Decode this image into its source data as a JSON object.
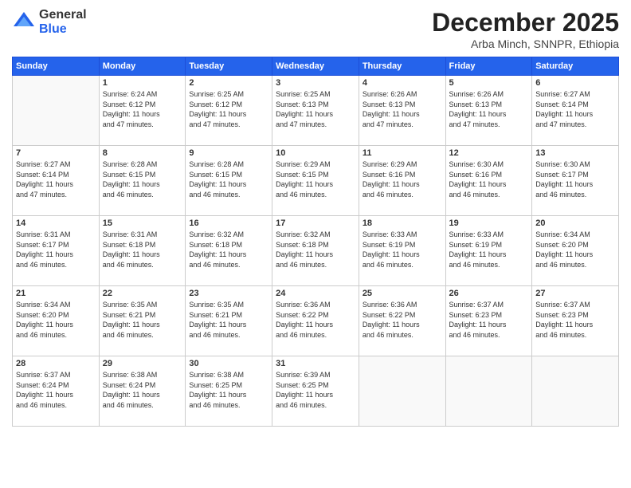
{
  "logo": {
    "general": "General",
    "blue": "Blue"
  },
  "title": "December 2025",
  "subtitle": "Arba Minch, SNNPR, Ethiopia",
  "days_of_week": [
    "Sunday",
    "Monday",
    "Tuesday",
    "Wednesday",
    "Thursday",
    "Friday",
    "Saturday"
  ],
  "weeks": [
    [
      {
        "day": "",
        "info": ""
      },
      {
        "day": "1",
        "info": "Sunrise: 6:24 AM\nSunset: 6:12 PM\nDaylight: 11 hours\nand 47 minutes."
      },
      {
        "day": "2",
        "info": "Sunrise: 6:25 AM\nSunset: 6:12 PM\nDaylight: 11 hours\nand 47 minutes."
      },
      {
        "day": "3",
        "info": "Sunrise: 6:25 AM\nSunset: 6:13 PM\nDaylight: 11 hours\nand 47 minutes."
      },
      {
        "day": "4",
        "info": "Sunrise: 6:26 AM\nSunset: 6:13 PM\nDaylight: 11 hours\nand 47 minutes."
      },
      {
        "day": "5",
        "info": "Sunrise: 6:26 AM\nSunset: 6:13 PM\nDaylight: 11 hours\nand 47 minutes."
      },
      {
        "day": "6",
        "info": "Sunrise: 6:27 AM\nSunset: 6:14 PM\nDaylight: 11 hours\nand 47 minutes."
      }
    ],
    [
      {
        "day": "7",
        "info": "Sunrise: 6:27 AM\nSunset: 6:14 PM\nDaylight: 11 hours\nand 47 minutes."
      },
      {
        "day": "8",
        "info": "Sunrise: 6:28 AM\nSunset: 6:15 PM\nDaylight: 11 hours\nand 46 minutes."
      },
      {
        "day": "9",
        "info": "Sunrise: 6:28 AM\nSunset: 6:15 PM\nDaylight: 11 hours\nand 46 minutes."
      },
      {
        "day": "10",
        "info": "Sunrise: 6:29 AM\nSunset: 6:15 PM\nDaylight: 11 hours\nand 46 minutes."
      },
      {
        "day": "11",
        "info": "Sunrise: 6:29 AM\nSunset: 6:16 PM\nDaylight: 11 hours\nand 46 minutes."
      },
      {
        "day": "12",
        "info": "Sunrise: 6:30 AM\nSunset: 6:16 PM\nDaylight: 11 hours\nand 46 minutes."
      },
      {
        "day": "13",
        "info": "Sunrise: 6:30 AM\nSunset: 6:17 PM\nDaylight: 11 hours\nand 46 minutes."
      }
    ],
    [
      {
        "day": "14",
        "info": "Sunrise: 6:31 AM\nSunset: 6:17 PM\nDaylight: 11 hours\nand 46 minutes."
      },
      {
        "day": "15",
        "info": "Sunrise: 6:31 AM\nSunset: 6:18 PM\nDaylight: 11 hours\nand 46 minutes."
      },
      {
        "day": "16",
        "info": "Sunrise: 6:32 AM\nSunset: 6:18 PM\nDaylight: 11 hours\nand 46 minutes."
      },
      {
        "day": "17",
        "info": "Sunrise: 6:32 AM\nSunset: 6:18 PM\nDaylight: 11 hours\nand 46 minutes."
      },
      {
        "day": "18",
        "info": "Sunrise: 6:33 AM\nSunset: 6:19 PM\nDaylight: 11 hours\nand 46 minutes."
      },
      {
        "day": "19",
        "info": "Sunrise: 6:33 AM\nSunset: 6:19 PM\nDaylight: 11 hours\nand 46 minutes."
      },
      {
        "day": "20",
        "info": "Sunrise: 6:34 AM\nSunset: 6:20 PM\nDaylight: 11 hours\nand 46 minutes."
      }
    ],
    [
      {
        "day": "21",
        "info": "Sunrise: 6:34 AM\nSunset: 6:20 PM\nDaylight: 11 hours\nand 46 minutes."
      },
      {
        "day": "22",
        "info": "Sunrise: 6:35 AM\nSunset: 6:21 PM\nDaylight: 11 hours\nand 46 minutes."
      },
      {
        "day": "23",
        "info": "Sunrise: 6:35 AM\nSunset: 6:21 PM\nDaylight: 11 hours\nand 46 minutes."
      },
      {
        "day": "24",
        "info": "Sunrise: 6:36 AM\nSunset: 6:22 PM\nDaylight: 11 hours\nand 46 minutes."
      },
      {
        "day": "25",
        "info": "Sunrise: 6:36 AM\nSunset: 6:22 PM\nDaylight: 11 hours\nand 46 minutes."
      },
      {
        "day": "26",
        "info": "Sunrise: 6:37 AM\nSunset: 6:23 PM\nDaylight: 11 hours\nand 46 minutes."
      },
      {
        "day": "27",
        "info": "Sunrise: 6:37 AM\nSunset: 6:23 PM\nDaylight: 11 hours\nand 46 minutes."
      }
    ],
    [
      {
        "day": "28",
        "info": "Sunrise: 6:37 AM\nSunset: 6:24 PM\nDaylight: 11 hours\nand 46 minutes."
      },
      {
        "day": "29",
        "info": "Sunrise: 6:38 AM\nSunset: 6:24 PM\nDaylight: 11 hours\nand 46 minutes."
      },
      {
        "day": "30",
        "info": "Sunrise: 6:38 AM\nSunset: 6:25 PM\nDaylight: 11 hours\nand 46 minutes."
      },
      {
        "day": "31",
        "info": "Sunrise: 6:39 AM\nSunset: 6:25 PM\nDaylight: 11 hours\nand 46 minutes."
      },
      {
        "day": "",
        "info": ""
      },
      {
        "day": "",
        "info": ""
      },
      {
        "day": "",
        "info": ""
      }
    ]
  ]
}
